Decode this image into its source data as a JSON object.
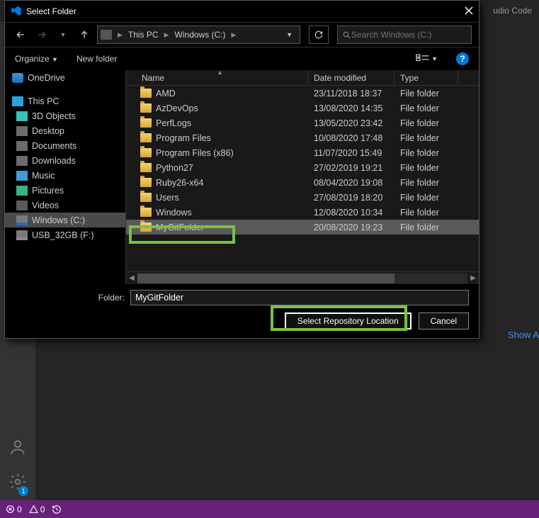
{
  "vscode": {
    "title_fragment": "udio Code",
    "show_all": "Show A",
    "gear_badge": "1",
    "errors": "0",
    "warnings": "0"
  },
  "dialog": {
    "title": "Select Folder",
    "breadcrumb": {
      "root": "This PC",
      "drive": "Windows (C:)"
    },
    "search_placeholder": "Search Windows (C:)",
    "toolbar": {
      "organize": "Organize",
      "new_folder": "New folder"
    },
    "columns": {
      "name": "Name",
      "date": "Date modified",
      "type": "Type"
    },
    "tree": [
      {
        "label": "OneDrive",
        "icon": "cloud",
        "root": true
      },
      {
        "label": "This PC",
        "icon": "pc",
        "root": true
      },
      {
        "label": "3D Objects",
        "icon": "cube"
      },
      {
        "label": "Desktop",
        "icon": "folder-dark"
      },
      {
        "label": "Documents",
        "icon": "folder-dark"
      },
      {
        "label": "Downloads",
        "icon": "folder-dark"
      },
      {
        "label": "Music",
        "icon": "music"
      },
      {
        "label": "Pictures",
        "icon": "pic"
      },
      {
        "label": "Videos",
        "icon": "video"
      },
      {
        "label": "Windows (C:)",
        "icon": "drive",
        "sel": true
      },
      {
        "label": "USB_32GB (F:)",
        "icon": "usb"
      }
    ],
    "rows": [
      {
        "name": "AMD",
        "date": "23/11/2018 18:37",
        "type": "File folder"
      },
      {
        "name": "AzDevOps",
        "date": "13/08/2020 14:35",
        "type": "File folder"
      },
      {
        "name": "PerfLogs",
        "date": "13/05/2020 23:42",
        "type": "File folder"
      },
      {
        "name": "Program Files",
        "date": "10/08/2020 17:48",
        "type": "File folder"
      },
      {
        "name": "Program Files (x86)",
        "date": "11/07/2020 15:49",
        "type": "File folder"
      },
      {
        "name": "Python27",
        "date": "27/02/2019 19:21",
        "type": "File folder"
      },
      {
        "name": "Ruby26-x64",
        "date": "08/04/2020 19:08",
        "type": "File folder"
      },
      {
        "name": "Users",
        "date": "27/08/2019 18:20",
        "type": "File folder"
      },
      {
        "name": "Windows",
        "date": "12/08/2020 10:34",
        "type": "File folder"
      },
      {
        "name": "MyGitFolder",
        "date": "20/08/2020 19:23",
        "type": "File folder",
        "sel": true
      }
    ],
    "folder_label": "Folder:",
    "folder_value": "MyGitFolder",
    "select_btn": "Select Repository Location",
    "cancel_btn": "Cancel"
  }
}
